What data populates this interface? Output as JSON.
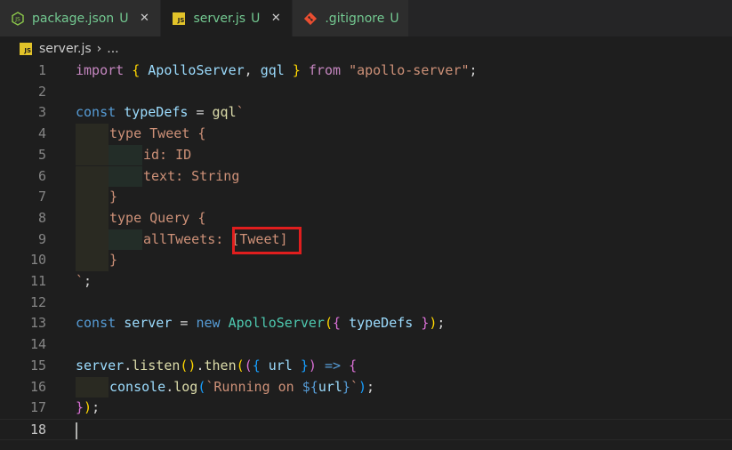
{
  "tabs": [
    {
      "label": "package.json",
      "status": "U",
      "icon": "nodejs-icon"
    },
    {
      "label": "server.js",
      "status": "U",
      "icon": "js-file-icon",
      "active": true
    },
    {
      "label": ".gitignore",
      "status": "U",
      "icon": "git-icon"
    }
  ],
  "tab_close": "✕",
  "breadcrumb": {
    "file": "server.js",
    "separator": "›",
    "more": "..."
  },
  "js_badge": "JS",
  "colors": {
    "accent_git": "#e94e31",
    "highlight_box": "#e01e1e",
    "untracked": "#73c991"
  },
  "line_numbers": [
    "1",
    "2",
    "3",
    "4",
    "5",
    "6",
    "7",
    "8",
    "9",
    "10",
    "11",
    "12",
    "13",
    "14",
    "15",
    "16",
    "17",
    "18"
  ],
  "code": {
    "l1": {
      "kw": "import",
      "b1": "{",
      "id1": "ApolloServer",
      "c": ",",
      "id2": "gql",
      "b2": "}",
      "kw2": "from",
      "str": "\"apollo-server\"",
      "end": ";"
    },
    "l3": {
      "kw": "const",
      "id": "typeDefs",
      "eq": "=",
      "fn": "gql",
      "tick": "`"
    },
    "l4": "type Tweet {",
    "l5": "id: ID",
    "l6": "text: String",
    "l7": "}",
    "l8": "type Query {",
    "l9a": "allTweets: ",
    "l9b": "[Tweet]",
    "l10": "}",
    "l11": {
      "tick": "`",
      "end": ";"
    },
    "l13": {
      "kw": "const",
      "id": "server",
      "eq": "=",
      "kw2": "new",
      "cls": "ApolloServer",
      "p1": "(",
      "b1": "{",
      "id2": "typeDefs",
      "b2": "}",
      "p2": ")",
      "end": ";"
    },
    "l15": {
      "id": "server",
      "dot": ".",
      "fn": "listen",
      "p1": "()",
      "dot2": ".",
      "fn2": "then",
      "p2": "(",
      "p3": "(",
      "b1": "{",
      "id2": "url",
      "b2": "}",
      "p4": ")",
      "arrow": "=>",
      "b3": "{"
    },
    "l16": {
      "id": "console",
      "dot": ".",
      "fn": "log",
      "p1": "(",
      "str1": "`Running on ",
      "tmpl_open": "${",
      "id2": "url",
      "tmpl_close": "}",
      "str2": "`",
      "p2": ")",
      "end": ";"
    },
    "l17": {
      "b": "}",
      "p": ")",
      "end": ");"
    }
  }
}
